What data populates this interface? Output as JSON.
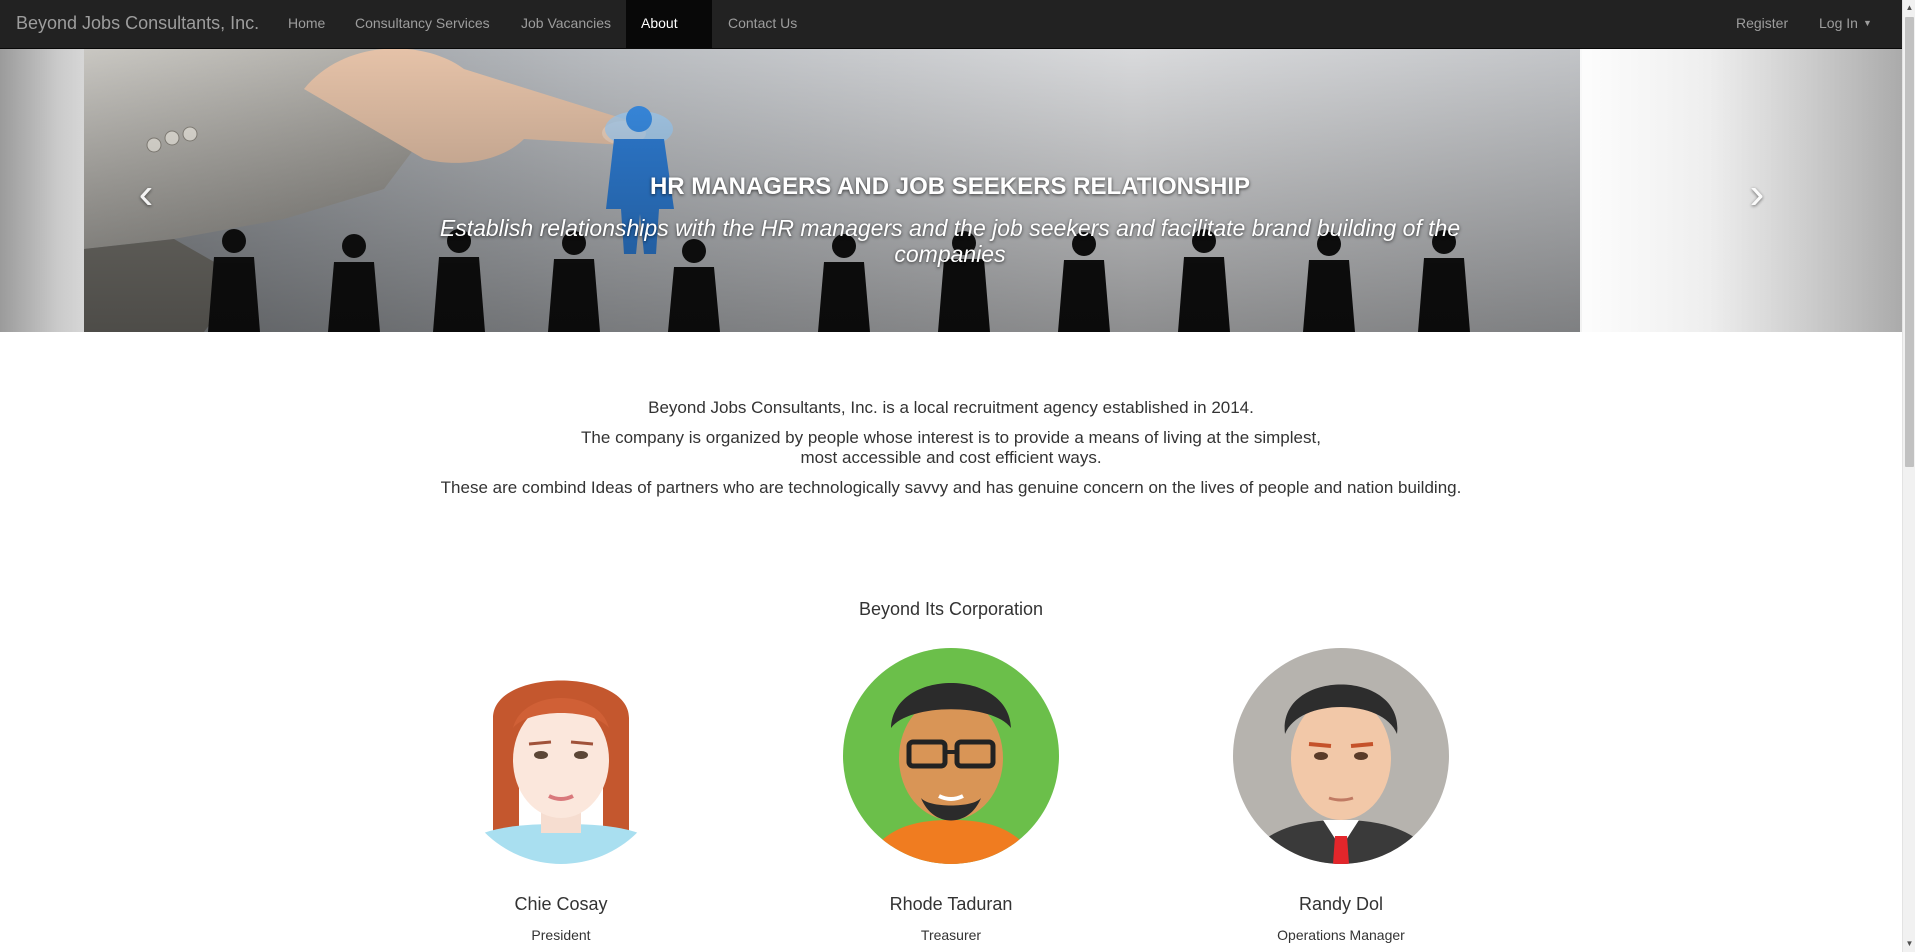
{
  "navbar": {
    "brand": "Beyond Jobs Consultants, Inc.",
    "links": [
      "Home",
      "Consultancy Services",
      "Job Vacancies",
      "About Us",
      "Contact Us"
    ],
    "active": "About Us",
    "register": "Register",
    "login": "Log In"
  },
  "carousel": {
    "title": "HR MANAGERS AND JOB SEEKERS RELATIONSHIP",
    "text": "Establish relationships with the HR managers and the job seekers and facilitate brand building of the companies",
    "slides": 3,
    "active_slide": 2,
    "prev_icon": "chevron-left-icon",
    "next_icon": "chevron-right-icon"
  },
  "about": {
    "line1": "Beyond Jobs Consultants, Inc. is a local recruitment agency established in 2014.",
    "line2a": "The company is organized by people whose interest is to provide a means of living at the simplest,",
    "line2b": "most accessible and cost efficient ways.",
    "line3": "These are combind Ideas of partners who are technologically savvy and has genuine concern on the lives of people and nation building."
  },
  "team": {
    "heading": "Beyond Its Corporation",
    "members": [
      {
        "name": "Chie Cosay",
        "role": "President"
      },
      {
        "name": "Rhode Taduran",
        "role": "Treasurer"
      },
      {
        "name": "Randy Dol",
        "role": "Operations Manager"
      }
    ]
  },
  "colors": {
    "navbar": "#222222",
    "nav_active": "#080808",
    "nav_text": "#9d9d9d",
    "text": "#333333"
  }
}
